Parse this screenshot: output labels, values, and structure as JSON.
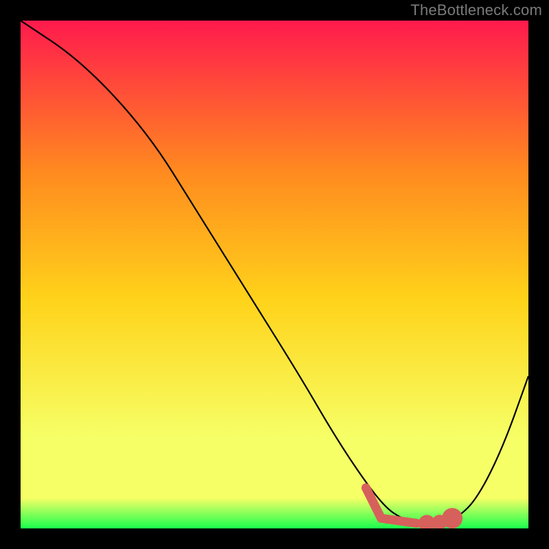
{
  "attribution": "TheBottleneck.com",
  "colors": {
    "frame_bg": "#000000",
    "attribution_text": "#7a7a7a",
    "gradient_top": "#ff1a4d",
    "gradient_mid_upper": "#ff8b1f",
    "gradient_mid": "#ffd31a",
    "gradient_lower": "#f6ff66",
    "gradient_bottom": "#1aff4d",
    "curve_stroke": "#000000",
    "marker_fill": "#d6605b",
    "marker_stroke": "#d6605b"
  },
  "chart_data": {
    "type": "line",
    "title": "",
    "xlabel": "",
    "ylabel": "",
    "xlim": [
      0,
      100
    ],
    "ylim": [
      0,
      100
    ],
    "grid": false,
    "legend": false,
    "series": [
      {
        "name": "bottleneck-curve",
        "x": [
          0,
          12,
          25,
          35,
          45,
          55,
          62,
          68,
          72,
          75,
          78,
          82,
          86,
          90,
          95,
          100
        ],
        "y": [
          100,
          92,
          78,
          62,
          46,
          30,
          18,
          9,
          4,
          2,
          1,
          1,
          2,
          6,
          16,
          30
        ]
      }
    ],
    "markers": [
      {
        "name": "highlight-start",
        "shape": "segment",
        "x0": 68,
        "y0": 8,
        "x1": 71,
        "y1": 2
      },
      {
        "name": "highlight-flat",
        "shape": "segment",
        "x0": 71,
        "y0": 2,
        "x1": 78,
        "y1": 1
      },
      {
        "name": "highlight-dot-1",
        "shape": "dot",
        "x": 80,
        "y": 1,
        "r": 1.4
      },
      {
        "name": "highlight-dot-2",
        "shape": "dot",
        "x": 82.5,
        "y": 1.2,
        "r": 1.2
      },
      {
        "name": "highlight-dot-3",
        "shape": "dot",
        "x": 85,
        "y": 2,
        "r": 1.8
      }
    ]
  }
}
